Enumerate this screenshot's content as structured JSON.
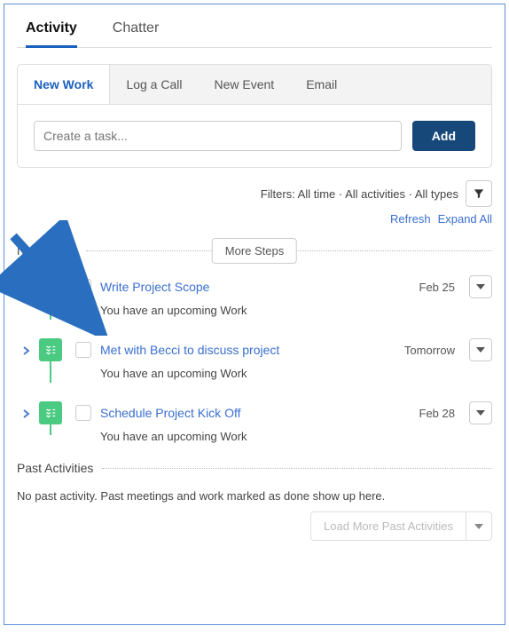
{
  "topTabs": {
    "activity": "Activity",
    "chatter": "Chatter"
  },
  "innerTabs": {
    "newWork": "New Work",
    "logCall": "Log a Call",
    "newEvent": "New Event",
    "email": "Email"
  },
  "taskInput": {
    "placeholder": "Create a task...",
    "addLabel": "Add"
  },
  "filters": {
    "label": "Filters: All time · All activities · All types",
    "refresh": "Refresh",
    "expandAll": "Expand All"
  },
  "sections": {
    "nextSteps": "Next Steps",
    "moreSteps": "More Steps",
    "pastActivities": "Past Activities"
  },
  "items": [
    {
      "title": "Write Project Scope",
      "date": "Feb 25",
      "sub": "You have an upcoming Work"
    },
    {
      "title": "Met with Becci to discuss project",
      "date": "Tomorrow",
      "sub": "You have an upcoming Work"
    },
    {
      "title": "Schedule Project Kick Off",
      "date": "Feb 28",
      "sub": "You have an upcoming Work"
    }
  ],
  "past": {
    "empty": "No past activity. Past meetings and work marked as done show up here.",
    "loadMore": "Load More Past Activities"
  },
  "colors": {
    "accent": "#1b5fbf",
    "link": "#3a6fd1",
    "green": "#4bca81",
    "navy": "#16487a"
  }
}
